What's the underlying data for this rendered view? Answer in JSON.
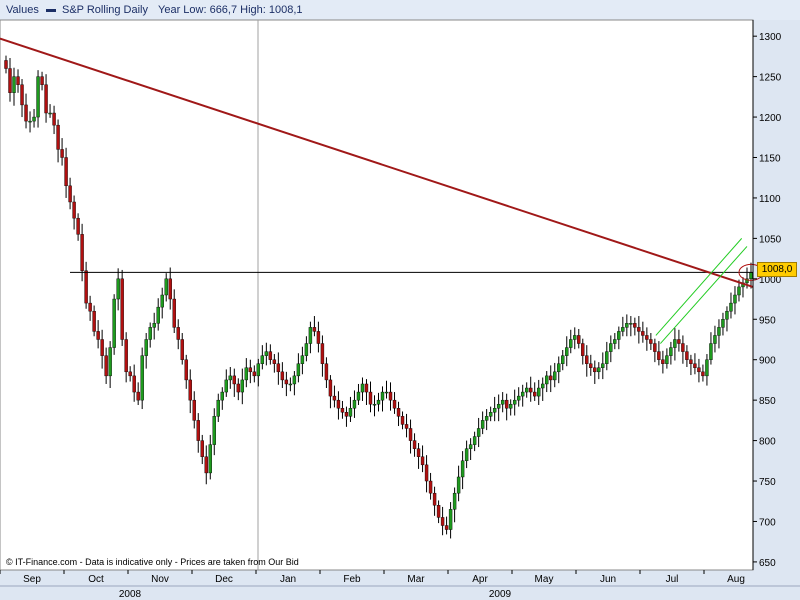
{
  "legend": {
    "values_label": "Values",
    "series_name": "S&P Rolling Daily",
    "stats": "Year Low: 666,7  High: 1008,1"
  },
  "credit": "© IT-Finance.com - Data is indicative only - Prices are taken from Our Bid",
  "last_value_label": "1008,0",
  "colors": {
    "up": "#1e9a1e",
    "down": "#b01010",
    "trendline": "#a01818",
    "channel": "#22cc22",
    "plot_bg": "#ffffff",
    "panel_bg": "#dde6f2"
  },
  "chart_data": {
    "type": "candlestick",
    "title": "S&P Rolling Daily",
    "ylim": [
      640,
      1320
    ],
    "y_ticks": [
      650,
      700,
      750,
      800,
      850,
      900,
      950,
      1000,
      1050,
      1100,
      1150,
      1200,
      1250,
      1300
    ],
    "x_months": [
      "Sep",
      "Oct",
      "Nov",
      "Dec",
      "Jan",
      "Feb",
      "Mar",
      "Apr",
      "May",
      "Jun",
      "Jul",
      "Aug"
    ],
    "years": [
      "2008",
      "2009"
    ],
    "year_low": 666.7,
    "year_high": 1008.1,
    "last_value": 1008.0,
    "horizontal_line": 1008,
    "trendline": {
      "start": 1297,
      "end": 990
    },
    "closes": [
      1260,
      1230,
      1250,
      1240,
      1215,
      1195,
      1195,
      1200,
      1250,
      1240,
      1205,
      1205,
      1190,
      1160,
      1150,
      1115,
      1095,
      1075,
      1055,
      1010,
      970,
      960,
      935,
      925,
      905,
      880,
      915,
      975,
      1000,
      925,
      885,
      880,
      860,
      850,
      905,
      925,
      940,
      945,
      965,
      980,
      1000,
      975,
      940,
      925,
      900,
      875,
      850,
      825,
      800,
      780,
      760,
      795,
      830,
      850,
      860,
      875,
      880,
      870,
      860,
      875,
      890,
      885,
      880,
      895,
      905,
      910,
      900,
      895,
      885,
      875,
      870,
      870,
      880,
      895,
      905,
      920,
      940,
      935,
      920,
      895,
      875,
      855,
      850,
      840,
      835,
      830,
      840,
      850,
      860,
      870,
      860,
      845,
      845,
      850,
      860,
      860,
      850,
      840,
      830,
      820,
      815,
      800,
      790,
      780,
      770,
      750,
      735,
      720,
      705,
      695,
      690,
      715,
      735,
      755,
      775,
      790,
      795,
      805,
      815,
      825,
      830,
      835,
      840,
      845,
      850,
      840,
      845,
      850,
      855,
      860,
      865,
      860,
      855,
      865,
      870,
      880,
      875,
      885,
      895,
      905,
      915,
      925,
      930,
      920,
      905,
      895,
      890,
      885,
      890,
      895,
      910,
      920,
      925,
      935,
      940,
      945,
      945,
      940,
      935,
      930,
      925,
      920,
      910,
      900,
      895,
      905,
      915,
      925,
      920,
      910,
      900,
      895,
      890,
      885,
      880,
      900,
      920,
      930,
      940,
      950,
      960,
      970,
      980,
      990,
      995,
      1000,
      1008
    ],
    "channel_lines": [
      {
        "from": [
          0.871,
          930
        ],
        "to": [
          0.985,
          1050
        ]
      },
      {
        "from": [
          0.877,
          920
        ],
        "to": [
          0.992,
          1040
        ]
      }
    ]
  }
}
